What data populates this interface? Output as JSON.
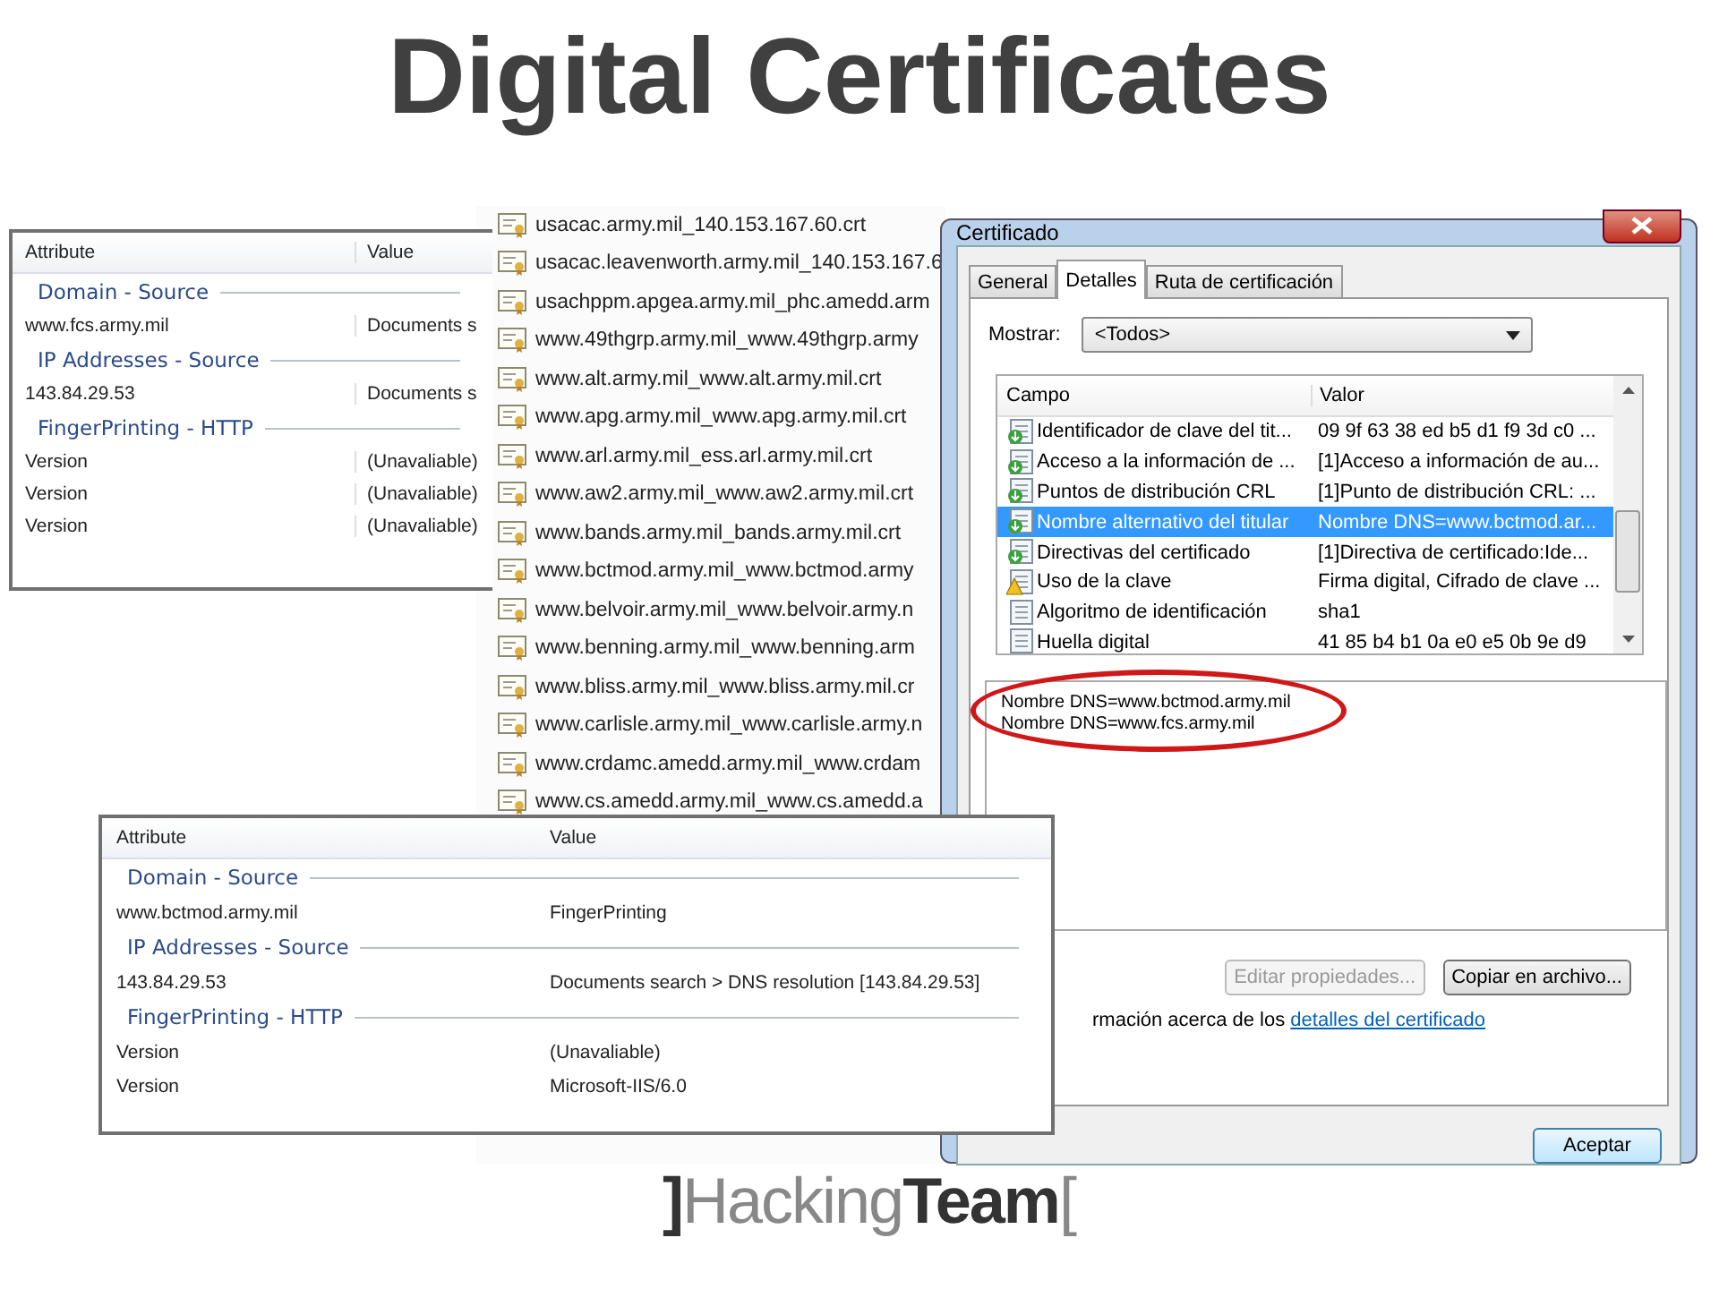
{
  "title": "Digital Certificates",
  "panel_top": {
    "columns": [
      "Attribute",
      "Value"
    ],
    "groups": [
      {
        "heading": "Domain - Source",
        "rows": [
          [
            "www.fcs.army.mil",
            "Documents s"
          ]
        ]
      },
      {
        "heading": "IP Addresses - Source",
        "rows": [
          [
            "143.84.29.53",
            "Documents s"
          ]
        ]
      },
      {
        "heading": "FingerPrinting - HTTP",
        "rows": [
          [
            "Version",
            "(Unavaliable)"
          ],
          [
            "Version",
            "(Unavaliable)"
          ],
          [
            "Version",
            "(Unavaliable)"
          ]
        ]
      }
    ]
  },
  "file_list": {
    "items": [
      "usacac.army.mil_140.153.167.60.crt",
      "usacac.leavenworth.army.mil_140.153.167.6",
      "usachppm.apgea.army.mil_phc.amedd.arm",
      "www.49thgrp.army.mil_www.49thgrp.army",
      "www.alt.army.mil_www.alt.army.mil.crt",
      "www.apg.army.mil_www.apg.army.mil.crt",
      "www.arl.army.mil_ess.arl.army.mil.crt",
      "www.aw2.army.mil_www.aw2.army.mil.crt",
      "www.bands.army.mil_bands.army.mil.crt",
      "www.bctmod.army.mil_www.bctmod.army",
      "www.belvoir.army.mil_www.belvoir.army.n",
      "www.benning.army.mil_www.benning.arm",
      "www.bliss.army.mil_www.bliss.army.mil.cr",
      "www.carlisle.army.mil_www.carlisle.army.n",
      "www.crdamc.amedd.army.mil_www.crdam",
      "www.cs.amedd.army.mil_www.cs.amedd.a"
    ]
  },
  "certificate_dialog": {
    "title": "Certificado",
    "tabs": [
      {
        "label": "General",
        "selected": false
      },
      {
        "label": "Detalles",
        "selected": true
      },
      {
        "label": "Ruta de certificación",
        "selected": false
      }
    ],
    "show_label": "Mostrar:",
    "show_value": "<Todos>",
    "columns": [
      "Campo",
      "Valor"
    ],
    "fields": [
      {
        "kind": "info",
        "name": "Identificador de clave del tit...",
        "value": "09 9f 63 38 ed b5 d1 f9 3d c0 ...",
        "selected": false
      },
      {
        "kind": "info",
        "name": "Acceso a la información de ...",
        "value": "[1]Acceso a información de au...",
        "selected": false
      },
      {
        "kind": "info",
        "name": "Puntos de distribución CRL",
        "value": "[1]Punto de distribución CRL: ...",
        "selected": false
      },
      {
        "kind": "info",
        "name": "Nombre alternativo del titular",
        "value": "Nombre DNS=www.bctmod.ar...",
        "selected": true
      },
      {
        "kind": "info",
        "name": "Directivas del certificado",
        "value": "[1]Directiva de certificado:Ide...",
        "selected": false
      },
      {
        "kind": "warning",
        "name": "Uso de la clave",
        "value": "Firma digital, Cifrado de clave ...",
        "selected": false
      },
      {
        "kind": "plain",
        "name": "Algoritmo de identificación",
        "value": "sha1",
        "selected": false
      },
      {
        "kind": "plain",
        "name": "Huella digital",
        "value": "41 85 b4 b1 0a e0 e5 0b 9e d9",
        "selected": false
      }
    ],
    "detail_lines": [
      "Nombre DNS=www.bctmod.army.mil",
      "Nombre DNS=www.fcs.army.mil"
    ],
    "buttons": [
      {
        "label": "Editar propiedades...",
        "disabled": true
      },
      {
        "label": "Copiar en archivo...",
        "disabled": false
      }
    ],
    "info_text": "rmación acerca de los ",
    "info_link": "detalles del certificado",
    "ok_button": "Aceptar"
  },
  "panel_bottom": {
    "columns": [
      "Attribute",
      "Value"
    ],
    "groups": [
      {
        "heading": "Domain - Source",
        "rows": [
          [
            "www.bctmod.army.mil",
            "FingerPrinting"
          ]
        ]
      },
      {
        "heading": "IP Addresses - Source",
        "rows": [
          [
            "143.84.29.53",
            "Documents search > DNS resolution [143.84.29.53]"
          ]
        ]
      },
      {
        "heading": "FingerPrinting - HTTP",
        "rows": [
          [
            "Version",
            "(Unavaliable)"
          ],
          [
            "Version",
            "Microsoft-IIS/6.0"
          ]
        ]
      }
    ]
  },
  "logo": {
    "open": "]",
    "light": "Hacking",
    "bold": "Team",
    "close": "["
  }
}
